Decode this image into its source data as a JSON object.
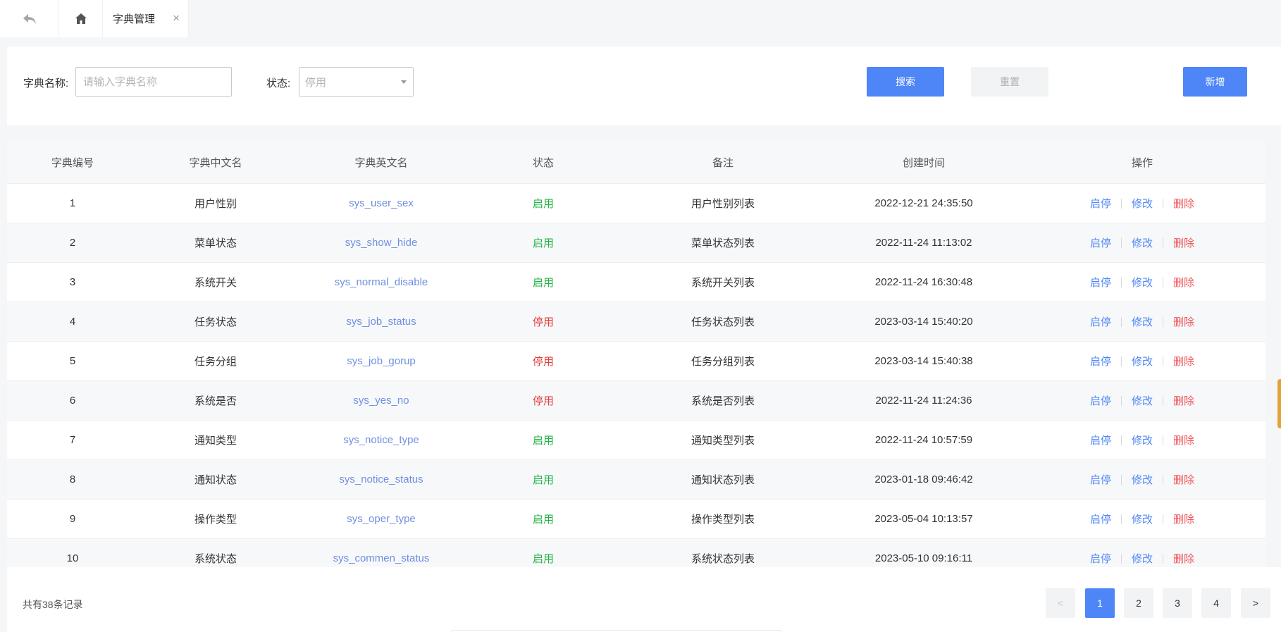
{
  "tabbar": {
    "active_tab": "字典管理",
    "close_symbol": "×"
  },
  "search": {
    "name_label": "字典名称:",
    "name_placeholder": "请输入字典名称",
    "status_label": "状态:",
    "status_value": "停用",
    "search_button": "搜索",
    "reset_button": "重置",
    "add_button": "新增"
  },
  "table": {
    "columns": [
      "字典编号",
      "字典中文名",
      "字典英文名",
      "状态",
      "备注",
      "创建时间",
      "操作"
    ],
    "actions": {
      "toggle": "启停",
      "edit": "修改",
      "delete": "删除"
    },
    "rows": [
      {
        "id": "1",
        "cn": "用户性别",
        "en": "sys_user_sex",
        "status": "启用",
        "remark": "用户性别列表",
        "created": "2022-12-21 24:35:50"
      },
      {
        "id": "2",
        "cn": "菜单状态",
        "en": "sys_show_hide",
        "status": "启用",
        "remark": "菜单状态列表",
        "created": "2022-11-24 11:13:02"
      },
      {
        "id": "3",
        "cn": "系统开关",
        "en": "sys_normal_disable",
        "status": "启用",
        "remark": "系统开关列表",
        "created": "2022-11-24 16:30:48"
      },
      {
        "id": "4",
        "cn": "任务状态",
        "en": "sys_job_status",
        "status": "停用",
        "remark": "任务状态列表",
        "created": "2023-03-14 15:40:20"
      },
      {
        "id": "5",
        "cn": "任务分组",
        "en": "sys_job_gorup",
        "status": "停用",
        "remark": "任务分组列表",
        "created": "2023-03-14 15:40:38"
      },
      {
        "id": "6",
        "cn": "系统是否",
        "en": "sys_yes_no",
        "status": "停用",
        "remark": "系统是否列表",
        "created": "2022-11-24 11:24:36"
      },
      {
        "id": "7",
        "cn": "通知类型",
        "en": "sys_notice_type",
        "status": "启用",
        "remark": "通知类型列表",
        "created": "2022-11-24 10:57:59"
      },
      {
        "id": "8",
        "cn": "通知状态",
        "en": "sys_notice_status",
        "status": "启用",
        "remark": "通知状态列表",
        "created": "2023-01-18 09:46:42"
      },
      {
        "id": "9",
        "cn": "操作类型",
        "en": "sys_oper_type",
        "status": "启用",
        "remark": "操作类型列表",
        "created": "2023-05-04 10:13:57"
      },
      {
        "id": "10",
        "cn": "系统状态",
        "en": "sys_commen_status",
        "status": "启用",
        "remark": "系统状态列表",
        "created": "2023-05-10 09:16:11"
      }
    ]
  },
  "pagination": {
    "total_text": "共有38条记录",
    "prev": "<",
    "next": ">",
    "pages": [
      "1",
      "2",
      "3",
      "4"
    ],
    "current": "1"
  },
  "colors": {
    "primary": "#4e86f7",
    "enabled": "#1fb141",
    "disabled": "#e23b3b",
    "delete": "#f0545a",
    "link": "#6f8fe0"
  },
  "icons": {
    "back": "back-arrow-icon",
    "home": "home-icon"
  }
}
